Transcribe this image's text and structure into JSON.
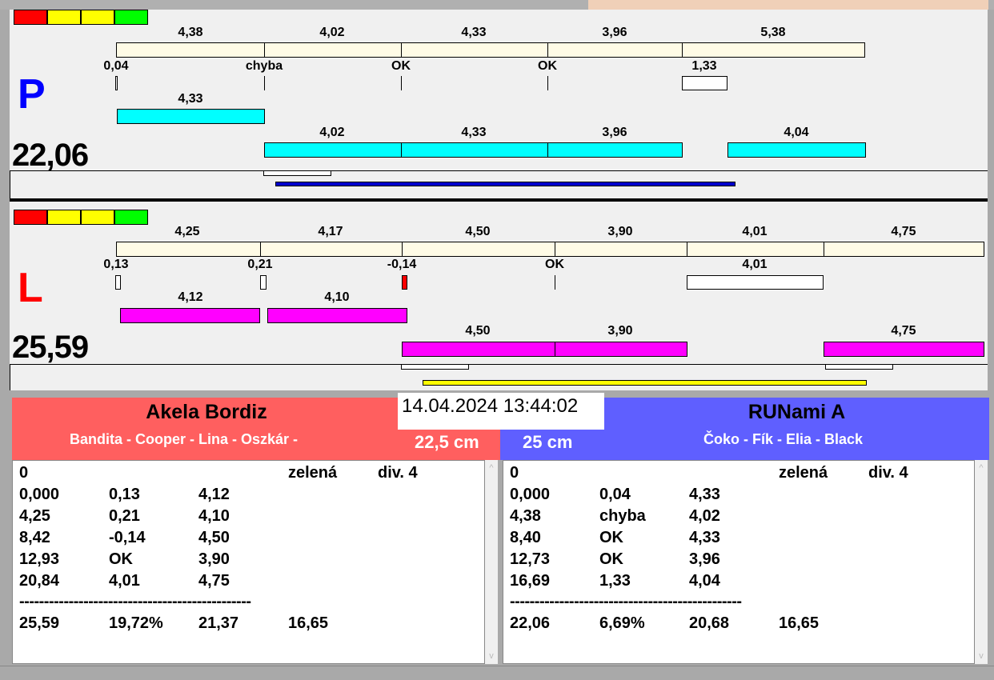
{
  "colors": {
    "signal": [
      "#ff0000",
      "#ffff00",
      "#ffff00",
      "#00ff00"
    ],
    "p_letter": "#0000ff",
    "l_letter": "#ff0000",
    "left_header": "#ff5f5f",
    "right_header": "#5f5fff"
  },
  "p": {
    "letter": "P",
    "total": "22,06",
    "row1": [
      "4,38",
      "4,02",
      "4,33",
      "3,96",
      "5,38"
    ],
    "row2": [
      "0,04",
      "chyba",
      "OK",
      "OK",
      "1,33"
    ],
    "row3": [
      "4,33"
    ],
    "row4": [
      "4,02",
      "4,33",
      "3,96",
      "4,04"
    ]
  },
  "l": {
    "letter": "L",
    "total": "25,59",
    "row1": [
      "4,25",
      "4,17",
      "4,50",
      "3,90",
      "4,01",
      "4,75"
    ],
    "row2": [
      "0,13",
      "0,21",
      "-0,14",
      "OK",
      "4,01"
    ],
    "row3": [
      "4,12",
      "4,10"
    ],
    "row4": [
      "4,50",
      "3,90",
      "4,75"
    ]
  },
  "datetime": "14.04.2024 13:44:02",
  "left": {
    "team": "Akela Bordiz",
    "dogs": "Bandita - Cooper - Lina - Oszkár -",
    "height": "22,5 cm",
    "rows": [
      [
        "0",
        "",
        "",
        "zelená",
        "div. 4"
      ],
      [
        "0,000",
        "0,13",
        "4,12",
        "",
        ""
      ],
      [
        "4,25",
        "0,21",
        "4,10",
        "",
        ""
      ],
      [
        "8,42",
        "-0,14",
        "4,50",
        "",
        ""
      ],
      [
        "12,93",
        "OK",
        "3,90",
        "",
        ""
      ],
      [
        "20,84",
        "4,01",
        "4,75",
        "",
        ""
      ]
    ],
    "separator": "-----------------------------------------------",
    "summary": [
      "25,59",
      "19,72%",
      "21,37",
      "16,65"
    ]
  },
  "right": {
    "team": "RUNami A",
    "dogs": "Čoko - Fík - Elia - Black",
    "height": "25 cm",
    "rows": [
      [
        "0",
        "",
        "",
        "zelená",
        "div. 4"
      ],
      [
        "0,000",
        "0,04",
        "4,33",
        "",
        ""
      ],
      [
        "4,38",
        "chyba",
        "4,02",
        "",
        ""
      ],
      [
        "8,40",
        "OK",
        "4,33",
        "",
        ""
      ],
      [
        "12,73",
        "OK",
        "3,96",
        "",
        ""
      ],
      [
        "16,69",
        "1,33",
        "4,04",
        "",
        ""
      ]
    ],
    "separator": "-----------------------------------------------",
    "summary": [
      "22,06",
      "6,69%",
      "20,68",
      "16,65"
    ]
  }
}
